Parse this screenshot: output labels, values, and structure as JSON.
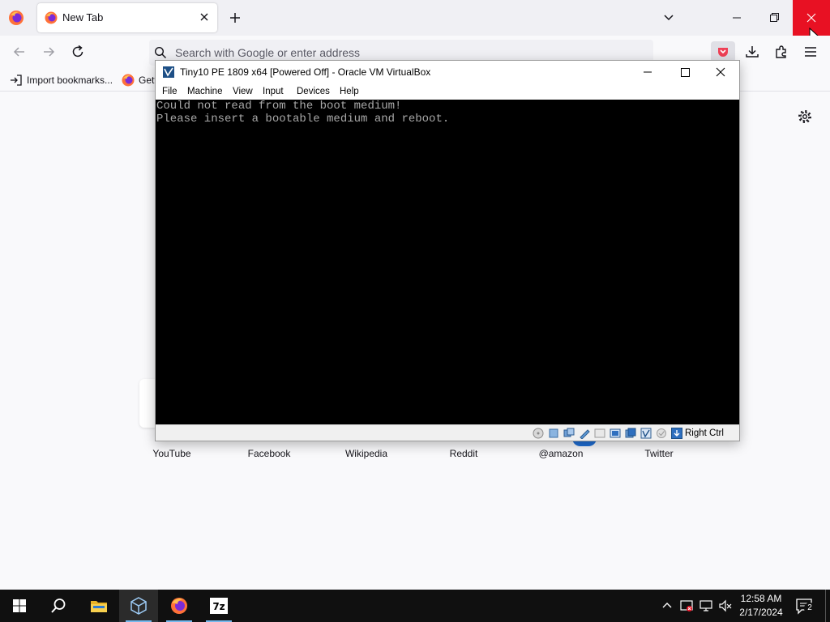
{
  "browser": {
    "tab": {
      "title": "New Tab"
    },
    "urlbar": {
      "placeholder": "Search with Google or enter address"
    },
    "bookmarks": [
      {
        "label": "Import bookmarks..."
      },
      {
        "label": "Gett"
      }
    ]
  },
  "newtab": {
    "shortcuts": [
      "YouTube",
      "Facebook",
      "Wikipedia",
      "Reddit",
      "@amazon",
      "Twitter"
    ]
  },
  "vbox": {
    "title": "Tiny10 PE 1809 x64 [Powered Off] - Oracle VM VirtualBox",
    "menu": [
      "File",
      "Machine",
      "View",
      "Input",
      "Devices",
      "Help"
    ],
    "console": [
      "Could not read from the boot medium!",
      "Please insert a bootable medium and reboot."
    ],
    "host_key": "Right Ctrl"
  },
  "taskbar": {
    "time": "12:58 AM",
    "date": "2/17/2024",
    "notifications": "2",
    "archiver_label": "7z"
  },
  "colors": {
    "firefox_orange": "#ff7139",
    "close_red": "#e81123",
    "pocket_red": "#ef4056",
    "taskbar_bg": "#101010"
  }
}
